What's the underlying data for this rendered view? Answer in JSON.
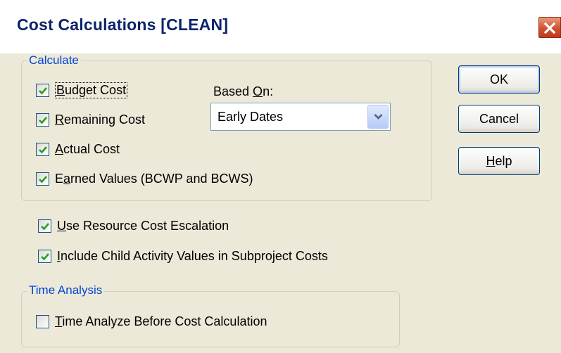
{
  "window": {
    "title": "Cost Calculations [CLEAN]"
  },
  "calculate": {
    "group_label": "Calculate",
    "budget_cost": {
      "pre": "",
      "key": "B",
      "post": "udget Cost",
      "checked": true
    },
    "remaining_cost": {
      "pre": "",
      "key": "R",
      "post": "emaining Cost",
      "checked": true
    },
    "actual_cost": {
      "pre": "",
      "key": "A",
      "post": "ctual Cost",
      "checked": true
    },
    "earned_values": {
      "pre": "E",
      "key": "a",
      "post": "rned Values (BCWP and BCWS)",
      "checked": true
    },
    "based_on": {
      "pre": "Based ",
      "key": "O",
      "post": "n:",
      "selected": "Early Dates"
    }
  },
  "options": {
    "escalation": {
      "pre": "",
      "key": "U",
      "post": "se Resource Cost Escalation",
      "checked": true
    },
    "child_values": {
      "pre": "",
      "key": "I",
      "post": "nclude Child Activity Values in Subproject Costs",
      "checked": true
    }
  },
  "time_analysis": {
    "group_label": "Time Analysis",
    "analyze_before": {
      "pre": "",
      "key": "T",
      "post": "ime Analyze Before Cost Calculation",
      "checked": false
    }
  },
  "buttons": {
    "ok": "OK",
    "cancel": "Cancel",
    "help": {
      "pre": "",
      "key": "H",
      "post": "elp"
    }
  },
  "colors": {
    "title": "#0a246a",
    "group_label": "#0046d5",
    "face": "#ece9d8",
    "check": "#21a121"
  },
  "icons": {
    "close": "close-icon",
    "check": "checkmark-icon",
    "dropdown": "chevron-down-icon"
  }
}
